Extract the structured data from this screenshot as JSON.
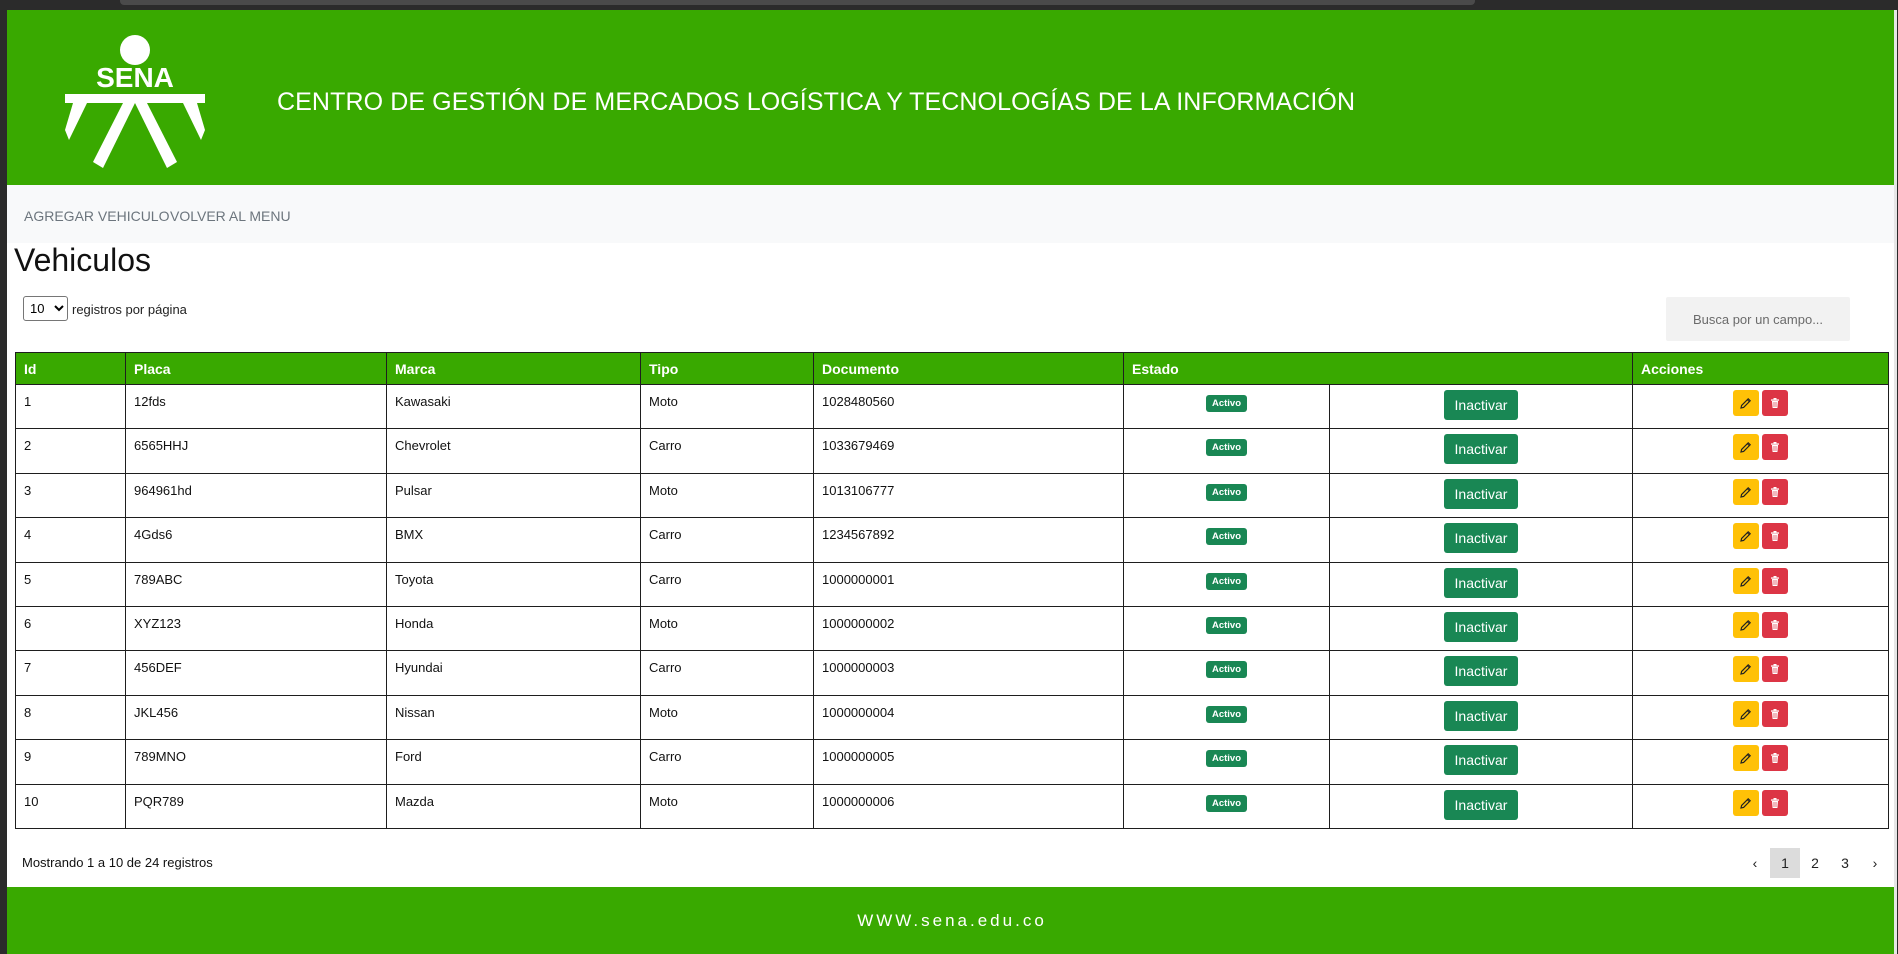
{
  "header": {
    "logo_text": "SENA",
    "institution": "CENTRO DE GESTIÓN DE MERCADOS LOGÍSTICA Y TECNOLOGÍAS DE LA INFORMACIÓN"
  },
  "nav": {
    "add_vehicle": "AGREGAR VEHICULO",
    "back_menu": "VOLVER AL MENU"
  },
  "page_title": "Vehiculos",
  "per_page": {
    "value": "10",
    "label": "registros por página"
  },
  "search": {
    "placeholder": "Busca por un campo..."
  },
  "table": {
    "headers": [
      "Id",
      "Placa",
      "Marca",
      "Tipo",
      "Documento",
      "Estado",
      "Acciones"
    ],
    "rows": [
      {
        "id": "1",
        "placa": "12fds",
        "marca": "Kawasaki",
        "tipo": "Moto",
        "documento": "1028480560",
        "estado": "Activo",
        "accion": "Inactivar"
      },
      {
        "id": "2",
        "placa": "6565HHJ",
        "marca": "Chevrolet",
        "tipo": "Carro",
        "documento": "1033679469",
        "estado": "Activo",
        "accion": "Inactivar"
      },
      {
        "id": "3",
        "placa": "964961hd",
        "marca": "Pulsar",
        "tipo": "Moto",
        "documento": "1013106777",
        "estado": "Activo",
        "accion": "Inactivar"
      },
      {
        "id": "4",
        "placa": "4Gds6",
        "marca": "BMX",
        "tipo": "Carro",
        "documento": "1234567892",
        "estado": "Activo",
        "accion": "Inactivar"
      },
      {
        "id": "5",
        "placa": "789ABC",
        "marca": "Toyota",
        "tipo": "Carro",
        "documento": "1000000001",
        "estado": "Activo",
        "accion": "Inactivar"
      },
      {
        "id": "6",
        "placa": "XYZ123",
        "marca": "Honda",
        "tipo": "Moto",
        "documento": "1000000002",
        "estado": "Activo",
        "accion": "Inactivar"
      },
      {
        "id": "7",
        "placa": "456DEF",
        "marca": "Hyundai",
        "tipo": "Carro",
        "documento": "1000000003",
        "estado": "Activo",
        "accion": "Inactivar"
      },
      {
        "id": "8",
        "placa": "JKL456",
        "marca": "Nissan",
        "tipo": "Moto",
        "documento": "1000000004",
        "estado": "Activo",
        "accion": "Inactivar"
      },
      {
        "id": "9",
        "placa": "789MNO",
        "marca": "Ford",
        "tipo": "Carro",
        "documento": "1000000005",
        "estado": "Activo",
        "accion": "Inactivar"
      },
      {
        "id": "10",
        "placa": "PQR789",
        "marca": "Mazda",
        "tipo": "Moto",
        "documento": "1000000006",
        "estado": "Activo",
        "accion": "Inactivar"
      }
    ]
  },
  "summary": "Mostrando 1 a 10 de 24 registros",
  "pagination": {
    "prev": "‹",
    "pages": [
      "1",
      "2",
      "3"
    ],
    "current": "1",
    "next": "›"
  },
  "footer": {
    "site": "WWW.sena.edu.co"
  },
  "colors": {
    "brand_green": "#39a900",
    "badge_green": "#198754",
    "edit_yellow": "#ffc107",
    "delete_red": "#dc3545"
  },
  "icons": {
    "edit": "pencil-icon",
    "delete": "trash-icon"
  }
}
